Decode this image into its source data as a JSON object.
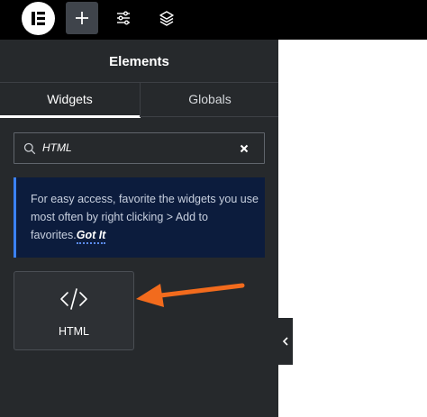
{
  "panel": {
    "title": "Elements"
  },
  "tabs": [
    {
      "label": "Widgets",
      "active": true
    },
    {
      "label": "Globals",
      "active": false
    }
  ],
  "search": {
    "value": "HTML"
  },
  "notice": {
    "text": "For easy access, favorite the widgets you use most often by right clicking > Add to favorites.",
    "link": "Got It"
  },
  "widgets": [
    {
      "label": "HTML",
      "icon": "code-icon"
    }
  ],
  "icons": {
    "logo": "elementor-logo-icon",
    "add": "plus-icon",
    "settings": "sliders-icon",
    "structure": "layers-icon",
    "collapse": "chevron-left-icon",
    "annotation": "orange-arrow-icon"
  },
  "colors": {
    "panel_bg": "#26292c",
    "topbar_bg": "#000000",
    "notice_bg": "#0c1c3d",
    "notice_accent": "#3b82f6",
    "annotation_arrow": "#f26b1d"
  }
}
